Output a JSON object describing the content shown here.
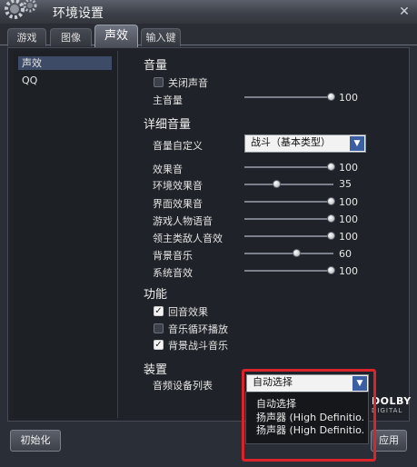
{
  "window": {
    "title": "环境设置",
    "close_glyph": "✕"
  },
  "tabs": [
    {
      "label": "游戏",
      "active": false
    },
    {
      "label": "图像",
      "active": false
    },
    {
      "label": "声效",
      "active": true
    },
    {
      "label": "输入键",
      "active": false
    }
  ],
  "sidebar": {
    "items": [
      {
        "label": "声效",
        "selected": true
      },
      {
        "label": "QQ",
        "selected": false
      }
    ]
  },
  "volume": {
    "heading": "音量",
    "mute_label": "关闭声音",
    "mute_checked": false,
    "master_label": "主音量",
    "master_value": "100"
  },
  "detail": {
    "heading": "详细音量",
    "preset_label": "音量自定义",
    "preset_value": "战斗（基本类型）",
    "sliders": [
      {
        "label": "效果音",
        "value": "100"
      },
      {
        "label": "环境效果音",
        "value": "35"
      },
      {
        "label": "界面效果音",
        "value": "100"
      },
      {
        "label": "游戏人物语音",
        "value": "100"
      },
      {
        "label": "领主类敌人音效",
        "value": "100"
      },
      {
        "label": "背景音乐",
        "value": "60"
      },
      {
        "label": "系统音效",
        "value": "100"
      }
    ]
  },
  "features": {
    "heading": "功能",
    "options": [
      {
        "label": "回音效果",
        "checked": true
      },
      {
        "label": "音乐循环播放",
        "checked": false
      },
      {
        "label": "背景战斗音乐",
        "checked": true
      }
    ]
  },
  "device": {
    "heading": "装置",
    "list_label": "音频设备列表",
    "selected": "自动选择",
    "options": [
      "自动选择",
      "扬声器 (High Definitio...",
      "扬声器 (High Definitio..."
    ]
  },
  "dolby": {
    "brand": "DOLBY",
    "sub": "DIGITAL"
  },
  "buttons": {
    "reset": "初始化",
    "apply": "应用"
  },
  "colors": {
    "accent_red": "#d8242a",
    "selection_blue": "#3d4b66"
  },
  "icons": {
    "window_icon": "gear-icon",
    "dropdown_arrow": "triangle-down-icon",
    "close": "close-icon"
  }
}
